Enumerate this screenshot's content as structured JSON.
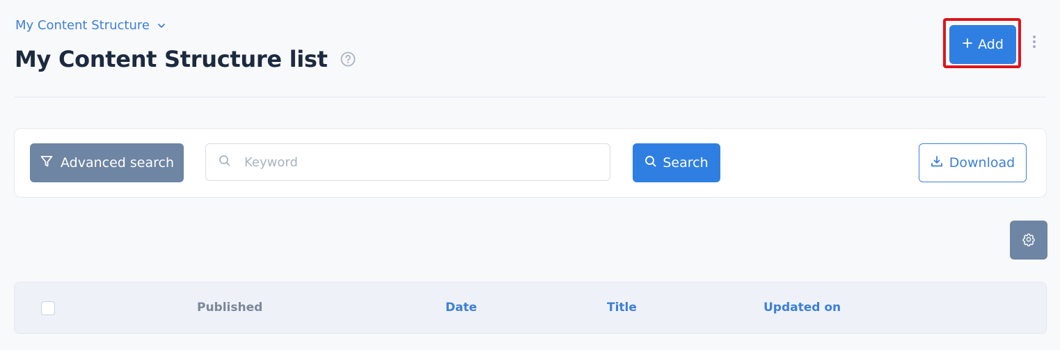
{
  "header": {
    "breadcrumb": "My Content Structure",
    "title": "My Content Structure list",
    "add_label": "Add"
  },
  "search": {
    "advanced_label": "Advanced search",
    "keyword_placeholder": "Keyword",
    "keyword_value": "",
    "search_label": "Search",
    "download_label": "Download"
  },
  "table": {
    "columns": [
      "Published",
      "Date",
      "Title",
      "Updated on"
    ]
  },
  "colors": {
    "primary": "#2f7fe3",
    "secondary": "#6e85a3",
    "link": "#3d7fd8",
    "highlight": "#e0131b"
  }
}
